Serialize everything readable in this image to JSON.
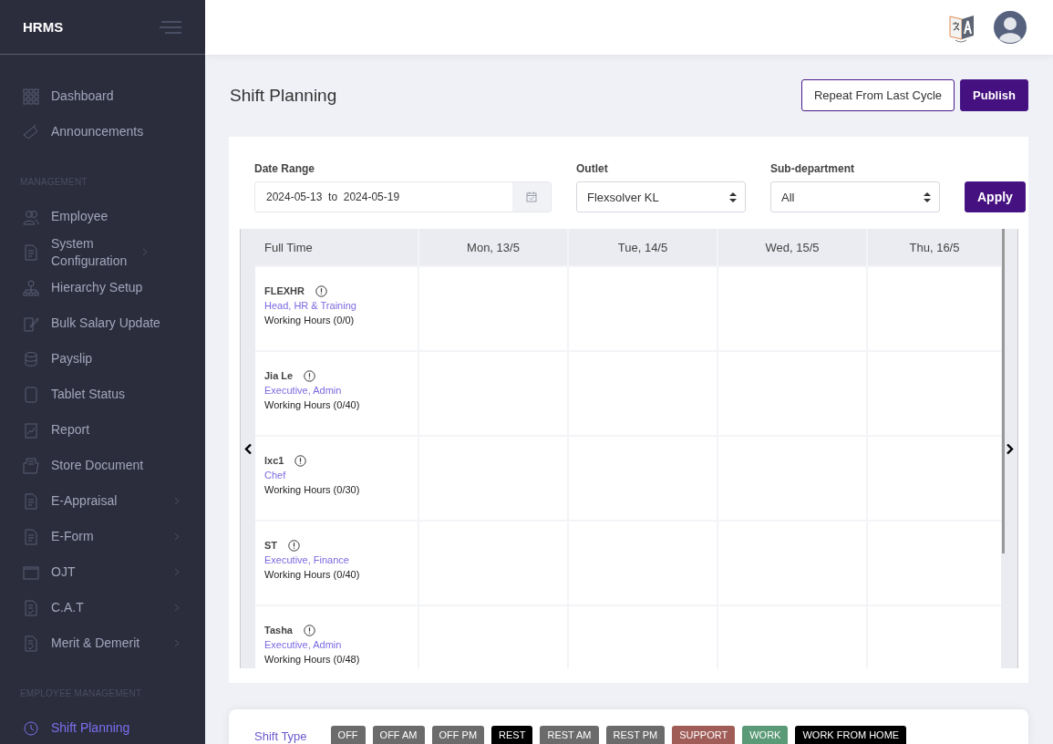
{
  "sidebar": {
    "brand": "HRMS",
    "groups": [
      {
        "items": [
          {
            "label": "Dashboard",
            "submenu": false,
            "selected": false
          },
          {
            "label": "Announcements",
            "submenu": false,
            "selected": false
          }
        ]
      },
      {
        "heading": "MANAGEMENT",
        "items": [
          {
            "label": "Employee",
            "submenu": false,
            "selected": false
          },
          {
            "label": "System Configuration",
            "submenu": true,
            "selected": false
          },
          {
            "label": "Hierarchy Setup",
            "submenu": false,
            "selected": false
          },
          {
            "label": "Bulk Salary Update",
            "submenu": false,
            "selected": false
          },
          {
            "label": "Payslip",
            "submenu": false,
            "selected": false
          },
          {
            "label": "Tablet Status",
            "submenu": false,
            "selected": false
          },
          {
            "label": "Report",
            "submenu": false,
            "selected": false
          },
          {
            "label": "Store Document",
            "submenu": false,
            "selected": false
          },
          {
            "label": "E-Appraisal",
            "submenu": true,
            "selected": false
          },
          {
            "label": "E-Form",
            "submenu": true,
            "selected": false
          },
          {
            "label": "OJT",
            "submenu": true,
            "selected": false
          },
          {
            "label": "C.A.T",
            "submenu": true,
            "selected": false
          },
          {
            "label": "Merit & Demerit",
            "submenu": true,
            "selected": false
          }
        ]
      },
      {
        "heading": "EMPLOYEE MANAGEMENT",
        "items": [
          {
            "label": "Shift Planning",
            "submenu": false,
            "selected": true
          }
        ]
      }
    ]
  },
  "page": {
    "title": "Shift Planning",
    "buttons": [
      {
        "label": "Repeat From Last Cycle",
        "kind": "outline"
      },
      {
        "label": "Publish",
        "kind": "primary"
      }
    ]
  },
  "filters": {
    "date_range": {
      "label": "Date Range",
      "value": "2024-05-13  to  2024-05-19"
    },
    "outlet": {
      "label": "Outlet",
      "value": "Flexsolver KL"
    },
    "sub_department": {
      "label": "Sub-department",
      "value": "All"
    },
    "apply": "Apply"
  },
  "schedule": {
    "group": "Full Time",
    "days": [
      "Mon, 13/5",
      "Tue, 14/5",
      "Wed, 15/5",
      "Thu, 16/5"
    ],
    "employees": [
      {
        "name": "FLEXHR",
        "position": "Head, HR & Training",
        "hours": "Working Hours (0/0)"
      },
      {
        "name": "Jia Le",
        "position": "Executive, Admin",
        "hours": "Working Hours (0/40)"
      },
      {
        "name": "lxc1",
        "position": "Chef",
        "hours": "Working Hours (0/30)"
      },
      {
        "name": "ST",
        "position": "Executive, Finance",
        "hours": "Working Hours (0/40)"
      },
      {
        "name": "Tasha",
        "position": "Executive, Admin",
        "hours": "Working Hours (0/48)"
      }
    ]
  },
  "legend": {
    "label": "Shift Type",
    "types": [
      {
        "label": "OFF",
        "color": "#6b6b6b"
      },
      {
        "label": "OFF AM",
        "color": "#6b6b6b"
      },
      {
        "label": "OFF PM",
        "color": "#6b6b6b"
      },
      {
        "label": "REST",
        "color": "#000000"
      },
      {
        "label": "REST AM",
        "color": "#6b6b6b"
      },
      {
        "label": "REST PM",
        "color": "#6b6b6b"
      },
      {
        "label": "SUPPORT",
        "color": "#a05c57"
      },
      {
        "label": "WORK",
        "color": "#5a9a76"
      },
      {
        "label": "WORK FROM HOME",
        "color": "#000000"
      }
    ]
  }
}
